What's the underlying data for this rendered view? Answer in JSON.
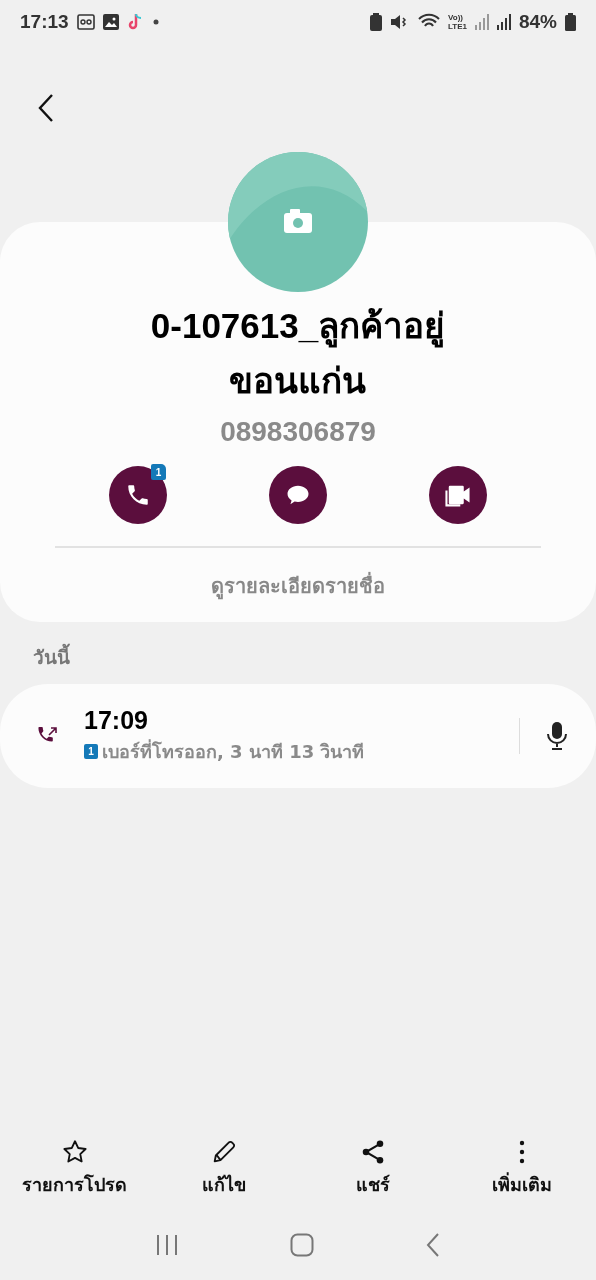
{
  "status_bar": {
    "time": "17:13",
    "network_top": "Vo))",
    "network_bottom": "LTE1",
    "battery": "84%"
  },
  "contact": {
    "name_lines": [
      "0-107613_ลูกค้าอยู่",
      "ขอนแก่น"
    ],
    "phone": "0898306879"
  },
  "actions": [
    {
      "kind": "call",
      "badge": "1"
    },
    {
      "kind": "message"
    },
    {
      "kind": "video"
    }
  ],
  "details_link": "ดูรายละเอียดรายชื่อ",
  "history": {
    "section": "วันนี้",
    "entries": [
      {
        "time": "17:09",
        "sim": "1",
        "description": "เบอร์ที่โทรออก, 3 นาที 13 วินาที"
      }
    ]
  },
  "bottom_bar": [
    {
      "kind": "star",
      "label": "รายการโปรด"
    },
    {
      "kind": "edit",
      "label": "แก้ไข"
    },
    {
      "kind": "share",
      "label": "แชร์"
    },
    {
      "kind": "more",
      "label": "เพิ่มเติม"
    }
  ]
}
